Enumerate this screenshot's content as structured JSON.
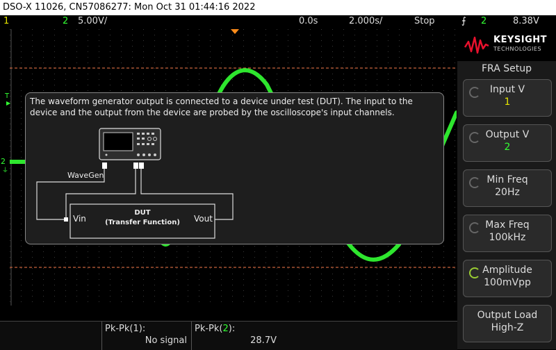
{
  "title_bar": "DSO-X 11026, CN57086277: Mon Oct 31 01:44:16 2022",
  "status": {
    "ch1": "1",
    "ch2": "2",
    "ch2_scale": "5.00V/",
    "time_offset": "0.0s",
    "time_scale": "2.000s/",
    "run_state": "Stop",
    "trigger_channel": "2",
    "trigger_level": "8.38V"
  },
  "colors": {
    "ch1": "#e6e600",
    "ch2": "#33ff33",
    "cursor_line": "#c8643c",
    "trigger_marker": "#ff8c1a"
  },
  "scope_markers": {
    "trigger_label": "T",
    "ch2_ground": "2"
  },
  "logo": {
    "brand": "KEYSIGHT",
    "subtitle": "TECHNOLOGIES"
  },
  "menu": {
    "title": "FRA Setup",
    "softkeys": [
      {
        "label": "Input V",
        "value": "1",
        "value_color": "#e6e600",
        "icon": "rotate-icon"
      },
      {
        "label": "Output V",
        "value": "2",
        "value_color": "#33ff33",
        "icon": "rotate-icon"
      },
      {
        "label": "Min Freq",
        "value": "20Hz",
        "value_color": "#dddddd",
        "icon": "rotate-icon"
      },
      {
        "label": "Max Freq",
        "value": "100kHz",
        "value_color": "#dddddd",
        "icon": "rotate-icon"
      },
      {
        "label": "Amplitude",
        "value": "100mVpp",
        "value_color": "#dddddd",
        "icon": "rotate-active-icon"
      },
      {
        "label": "Output Load",
        "value": "High-Z",
        "value_color": "#dddddd",
        "icon": "none"
      }
    ]
  },
  "measurements": {
    "pkpk1_label": "Pk-Pk(1):",
    "pkpk1_value": "No signal",
    "pkpk2_label_prefix": "Pk-Pk(",
    "pkpk2_channel": "2",
    "pkpk2_label_suffix": "):",
    "pkpk2_value": "28.7V"
  },
  "dialog": {
    "text": "The waveform generator output is connected to a device under test (DUT). The input to the device and the output from the device are probed by the oscilloscope's input channels.",
    "wavegen_label": "WaveGen",
    "dut_title": "DUT",
    "dut_subtitle": "(Transfer Function)",
    "vin_label": "Vin",
    "vout_label": "Vout"
  }
}
